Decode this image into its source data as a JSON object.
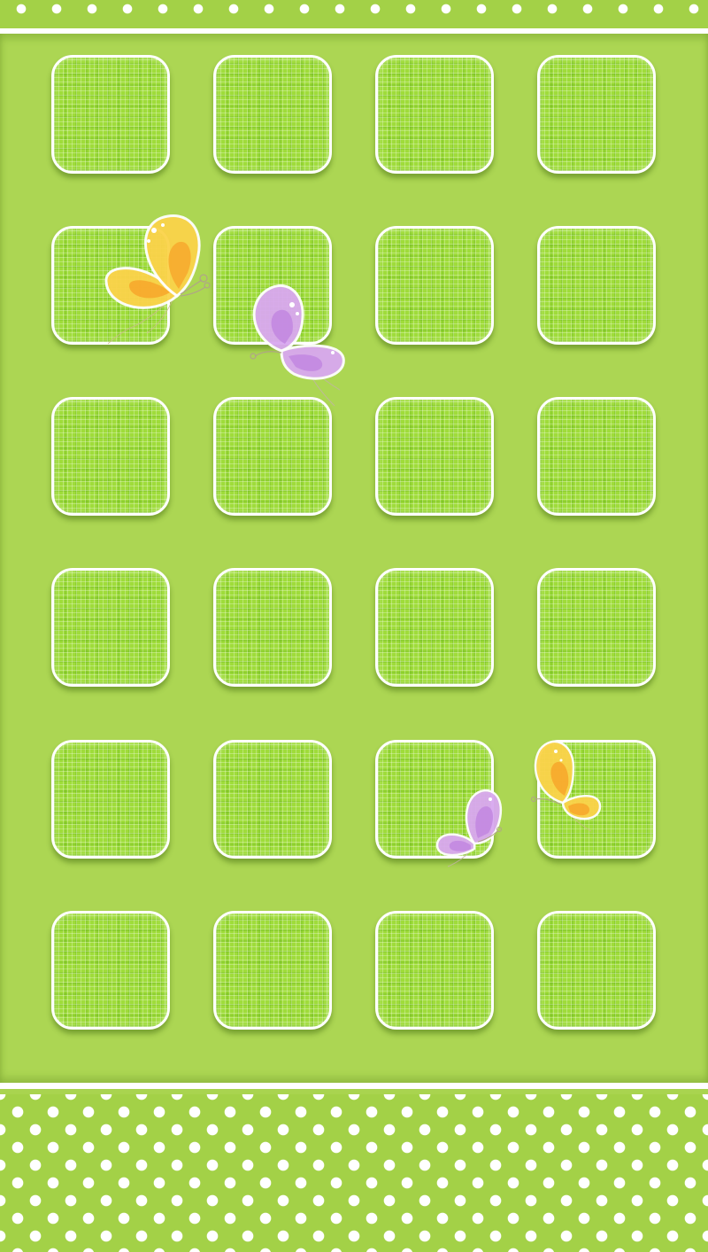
{
  "screen": {
    "name": "home-screen-wallpaper",
    "rows": 6,
    "columns": 4,
    "slot_count": 24
  },
  "colors": {
    "background": "#acd653",
    "dots_background": "#a3d147",
    "dot": "#ffffff",
    "slot_fill": "#9fdc3a",
    "slot_border": "#ffffff",
    "butterfly_yellow": "#fbd34a",
    "butterfly_yellow_inner": "#f7a62a",
    "butterfly_purple": "#d9a8f0",
    "butterfly_purple_inner": "#c084e0"
  },
  "decorations": {
    "butterflies": [
      {
        "name": "butterfly-yellow-large",
        "color": "yellow"
      },
      {
        "name": "butterfly-purple-large",
        "color": "purple"
      },
      {
        "name": "butterfly-purple-small",
        "color": "purple"
      },
      {
        "name": "butterfly-yellow-small",
        "color": "yellow"
      }
    ]
  }
}
